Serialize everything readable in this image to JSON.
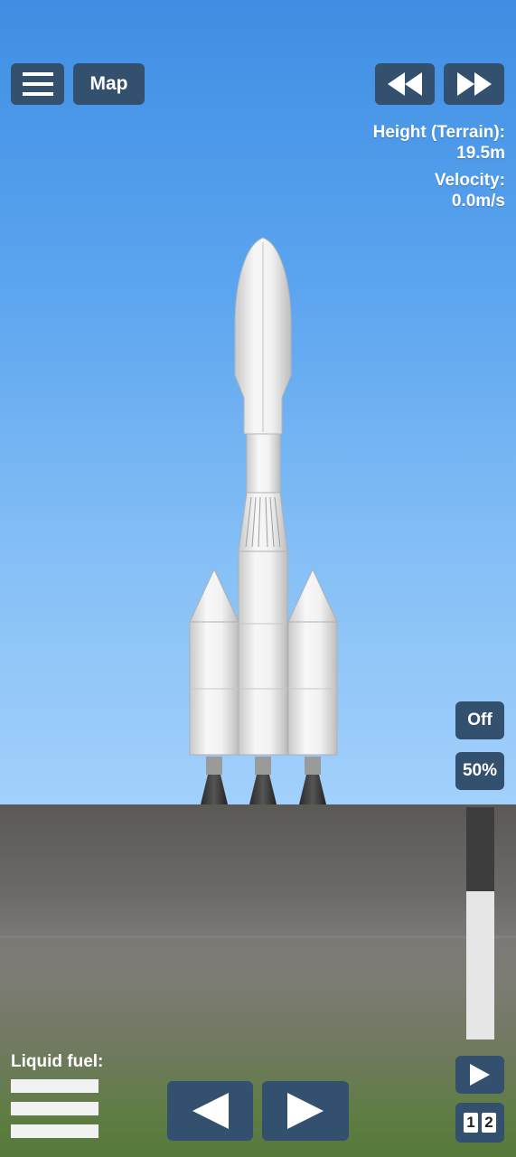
{
  "hud": {
    "menu_button": "menu-icon",
    "map_label": "Map",
    "rewind_icon": "rewind-icon",
    "fast_forward_icon": "fast-forward-icon",
    "height_label": "Height (Terrain):",
    "height_value": "19.5m",
    "velocity_label": "Velocity:",
    "velocity_value": "0.0m/s"
  },
  "controls": {
    "rcs_label": "Off",
    "throttle_label": "50%",
    "throttle_fill": 0.64,
    "play_icon": "play-icon",
    "stage_1": "1",
    "stage_2": "2",
    "left_icon": "arrow-left-icon",
    "right_icon": "arrow-right-icon"
  },
  "fuel": {
    "label": "Liquid fuel:"
  },
  "colors": {
    "button_bg": "#34506f",
    "sky_top": "#3f8ee3",
    "sky_bottom": "#a2d0fb",
    "ground": "#5a5955"
  }
}
